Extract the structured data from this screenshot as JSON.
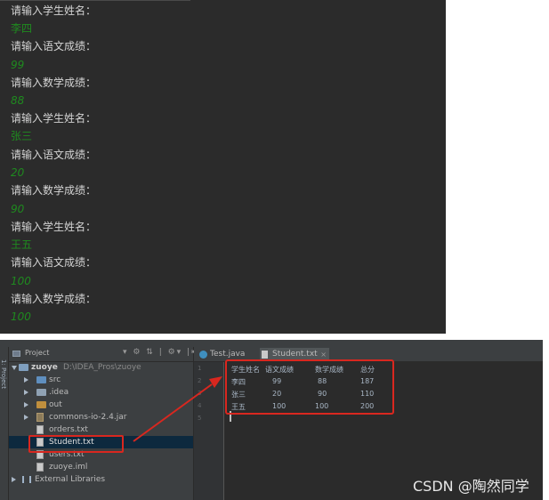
{
  "console": {
    "lines": [
      {
        "text": "请输入学生姓名：",
        "kind": "prompt"
      },
      {
        "text": "李四",
        "kind": "input"
      },
      {
        "text": "请输入语文成绩：",
        "kind": "prompt"
      },
      {
        "text": "99",
        "kind": "input"
      },
      {
        "text": "请输入数学成绩：",
        "kind": "prompt"
      },
      {
        "text": "88",
        "kind": "input"
      },
      {
        "text": "请输入学生姓名：",
        "kind": "prompt"
      },
      {
        "text": "张三",
        "kind": "input"
      },
      {
        "text": "请输入语文成绩：",
        "kind": "prompt"
      },
      {
        "text": "20",
        "kind": "input"
      },
      {
        "text": "请输入数学成绩：",
        "kind": "prompt"
      },
      {
        "text": "90",
        "kind": "input"
      },
      {
        "text": "请输入学生姓名：",
        "kind": "prompt"
      },
      {
        "text": "王五",
        "kind": "input"
      },
      {
        "text": "请输入语文成绩：",
        "kind": "prompt"
      },
      {
        "text": "100",
        "kind": "input"
      },
      {
        "text": "请输入数学成绩：",
        "kind": "prompt"
      },
      {
        "text": "100",
        "kind": "input"
      }
    ]
  },
  "ide": {
    "side_tab_label": "1: Project",
    "project_panel": {
      "title": "Project",
      "tools": "▾ ⚙ ⇅ | ⚙▾ |⇤"
    },
    "tree": {
      "root_name": "zuoye",
      "root_path": "D:\\IDEA_Pros\\zuoye",
      "items": {
        "src": "src",
        "idea": ".idea",
        "out": "out",
        "jar": "commons-io-2.4.jar",
        "orders": "orders.txt",
        "student": "Student.txt",
        "users": "users.txt",
        "iml": "zuoye.iml",
        "external": "External Libraries"
      }
    },
    "tabs": {
      "test": "Test.java",
      "student": "Student.txt",
      "close": "×"
    },
    "editor": {
      "line_numbers": [
        "1",
        "2",
        "3",
        "4",
        "5"
      ],
      "rows": [
        [
          "学生姓名",
          "语文成绩",
          "数学成绩",
          "总分"
        ],
        [
          "李四",
          "99",
          "88",
          "187"
        ],
        [
          "张三",
          "20",
          "90",
          "110"
        ],
        [
          "王五",
          "100",
          "100",
          "200"
        ]
      ]
    }
  },
  "colors": {
    "console_bg": "#2b2b2b",
    "prompt_text": "#d4d4d4",
    "input_text": "#1f8a1f",
    "highlight": "#d9271f"
  },
  "watermark": "CSDN @陶然同学"
}
